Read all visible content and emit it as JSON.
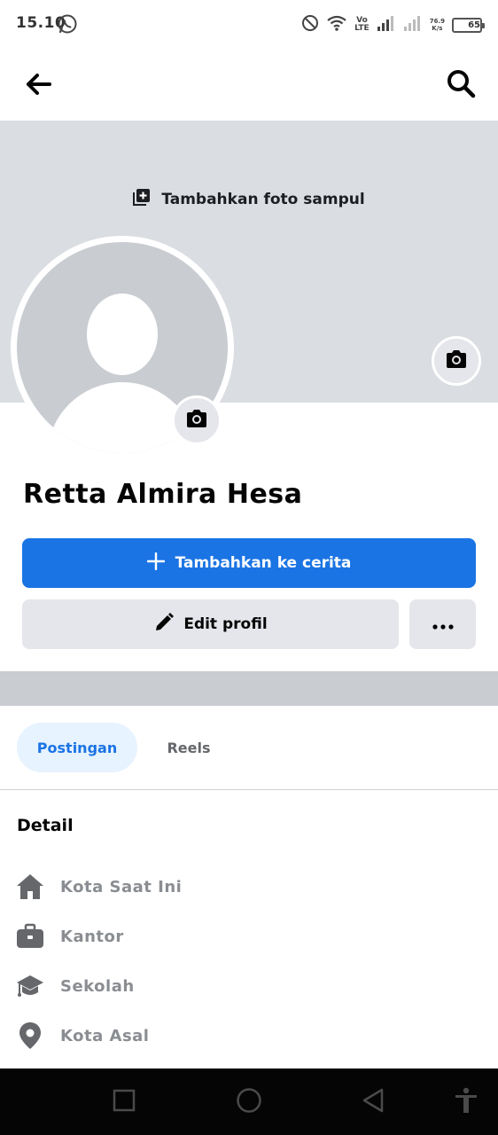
{
  "status_bar": {
    "time": "15.10",
    "volte_top": "Vo",
    "volte_bottom": "LTE",
    "speed_value": "76.9",
    "speed_unit": "K/s",
    "battery": "65",
    "battery_level": 0.65,
    "icons": [
      "whatsapp-icon",
      "do-not-disturb-icon",
      "wifi-icon",
      "signal-icon",
      "signal-icon",
      "battery-icon"
    ]
  },
  "header": {
    "back_icon": "arrow-left-icon",
    "search_icon": "search-icon"
  },
  "cover": {
    "add_cover_label": "Tambahkan foto sampul"
  },
  "profile": {
    "name": "Retta Almira Hesa"
  },
  "actions": {
    "add_story_label": "Tambahkan ke cerita",
    "edit_profile_label": "Edit profil",
    "more_icon": "more-icon"
  },
  "tabs": [
    {
      "label": "Postingan",
      "active": true
    },
    {
      "label": "Reels",
      "active": false
    }
  ],
  "details": {
    "title": "Detail",
    "items": [
      {
        "label": "Kota Saat Ini",
        "icon": "home-icon"
      },
      {
        "label": "Kantor",
        "icon": "briefcase-icon"
      },
      {
        "label": "Sekolah",
        "icon": "graduation-cap-icon"
      },
      {
        "label": "Kota Asal",
        "icon": "location-pin-icon"
      }
    ]
  },
  "colors": {
    "primary": "#1b74e4",
    "cover_bg": "#dadde1",
    "button_gray": "#e4e6eb",
    "tab_active_bg": "#e7f3ff",
    "muted_text": "#8a8d91"
  }
}
